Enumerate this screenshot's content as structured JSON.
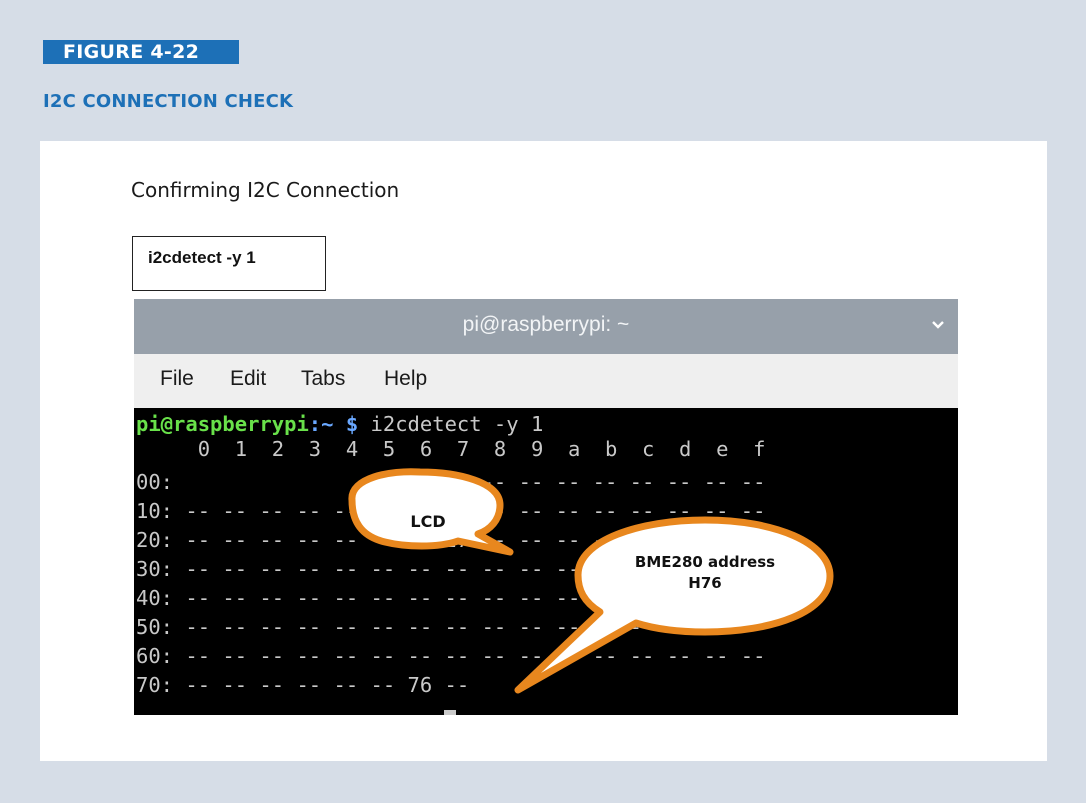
{
  "figure": {
    "tag": "FIGURE 4-22",
    "title": "I2C CONNECTION CHECK",
    "caption": "Confirming I2C Connection",
    "command_label": "i2cdetect -y 1"
  },
  "terminal": {
    "window_title": "pi@raspberrypi: ~",
    "menu": [
      "File",
      "Edit",
      "Tabs",
      "Help"
    ],
    "prompt_user": "pi@raspberrypi",
    "prompt_path": ":~ $",
    "command": " i2cdetect -y 1",
    "header_row": "     0  1  2  3  4  5  6  7  8  9  a  b  c  d  e  f",
    "rows": [
      "00:                         -- -- -- -- -- -- -- --",
      "10: -- -- -- -- -- -- -- -- -- -- -- -- -- -- -- --",
      "20: -- -- -- -- -- -- -- 27 -- -- -- -- -- -- -- --",
      "30: -- -- -- -- -- -- -- -- -- -- -- -- -- -- -- --",
      "40: -- -- -- -- -- -- -- -- -- -- -- -- -- -- -- --",
      "50: -- -- -- -- -- -- -- -- -- -- -- -- -- -- -- --",
      "60: -- -- -- -- -- -- -- -- -- -- -- -- -- -- -- --",
      "70: -- -- -- -- -- -- 76 --"
    ]
  },
  "callouts": {
    "lcd": "LCD",
    "bme_line1": "BME280 address",
    "bme_line2": "H76"
  },
  "colors": {
    "brand_blue": "#1d70b7",
    "callout_border": "#e8871e",
    "prompt_green": "#69e14a",
    "prompt_blue": "#6aa8ff"
  },
  "icons": {
    "window_menu": "chevron-down-icon"
  }
}
